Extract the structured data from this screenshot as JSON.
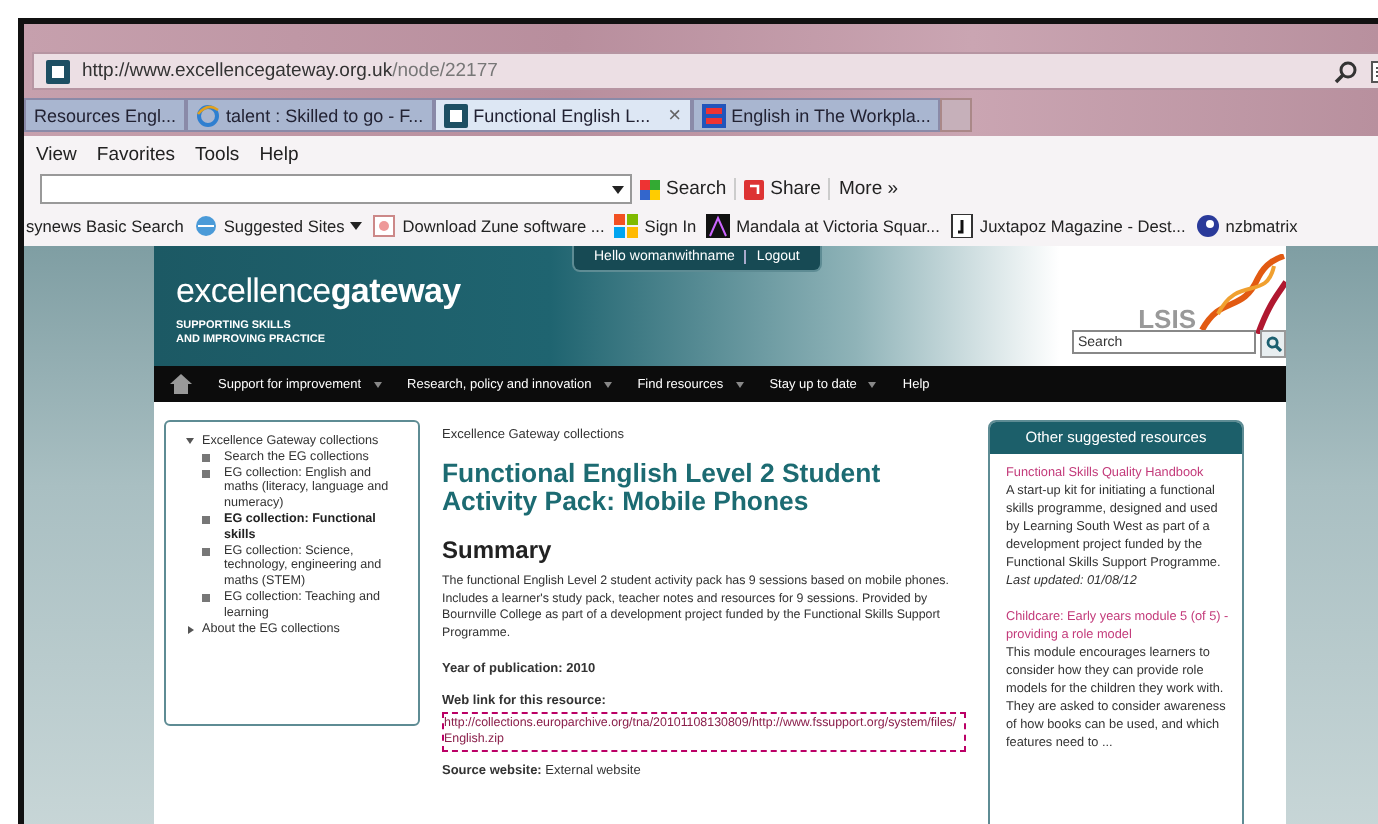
{
  "browser": {
    "url_host": "http://www.excellencegateway.org.uk",
    "url_path": "/node/22177",
    "tabs": [
      {
        "label": "Resources Engl...",
        "selected": false,
        "closable": false
      },
      {
        "label": "talent : Skilled to go - F...",
        "selected": false,
        "closable": false
      },
      {
        "label": "Functional English L...",
        "selected": true,
        "closable": true,
        "close_label": "×"
      },
      {
        "label": "English in The Workpla...",
        "selected": false,
        "closable": false
      }
    ],
    "menu": [
      "View",
      "Favorites",
      "Tools",
      "Help"
    ],
    "toolbar": {
      "search": "Search",
      "share": "Share",
      "more": "More »"
    },
    "favorites": [
      {
        "label": "synews Basic Search",
        "has_menu": false
      },
      {
        "label": "Suggested Sites",
        "has_menu": true
      },
      {
        "label": "Download Zune software ...",
        "has_menu": false
      },
      {
        "label": "Sign In",
        "has_menu": false
      },
      {
        "label": "Mandala at Victoria Squar...",
        "has_menu": false
      },
      {
        "label": "Juxtapoz Magazine - Dest...",
        "has_menu": false
      },
      {
        "label": "nzbmatrix",
        "has_menu": false
      }
    ]
  },
  "site": {
    "greeting": "Hello womanwithname",
    "logout": "Logout",
    "logo": "excellence**gateway**",
    "tagline": [
      "SUPPORTING SKILLS",
      "AND IMPROVING PRACTICE"
    ],
    "partner": "LSIS",
    "search": {
      "placeholder": "Search"
    },
    "nav": [
      {
        "label": "Support for improvement",
        "has_menu": true
      },
      {
        "label": "Research, policy and innovation",
        "has_menu": true
      },
      {
        "label": "Find resources",
        "has_menu": true
      },
      {
        "label": "Stay up to date",
        "has_menu": true
      },
      {
        "label": "Help",
        "has_menu": false
      }
    ]
  },
  "sidebar": {
    "items": [
      {
        "label": "Excellence Gateway collections",
        "expanded": true,
        "selected": false,
        "children": [
          {
            "label": "Search the EG collections",
            "selected": false
          },
          {
            "label": "EG collection: English and maths (literacy, language and numeracy)",
            "selected": false
          },
          {
            "label": "EG collection: Functional skills",
            "selected": true
          },
          {
            "label": "EG collection: Science, technology, engineering and maths (STEM)",
            "selected": false
          },
          {
            "label": "EG collection: Teaching and learning",
            "selected": false
          }
        ]
      },
      {
        "label": "About the EG collections",
        "expanded": false,
        "selected": false
      }
    ]
  },
  "main": {
    "breadcrumb": "Excellence Gateway collections",
    "title": "Functional English Level 2 Student Activity Pack: Mobile Phones",
    "heading": "Summary",
    "summary": "The functional English Level 2 student activity pack has 9 sessions based on mobile phones. Includes a learner's study pack, teacher notes and resources for 9 sessions. Provided by Bournville College as part of a development project funded by the Functional Skills Support Programme.",
    "year": "Year of publication: 2010",
    "web_link_label": "Web link for this resource:",
    "web_link": "http://collections.europarchive.org/tna/20101108130809/http://www.fssupport.org/system/files/English.zip",
    "source": "**Source website:** External website"
  },
  "suggested": {
    "heading": "Other suggested resources",
    "items": [
      {
        "title": "Functional Skills Quality Handbook",
        "description": "A start-up kit for initiating a functional skills programme, designed and used by Learning South West as part of a development project funded by the Functional Skills Support Programme.",
        "updated": "Last updated: 01/08/12"
      },
      {
        "title": "Childcare: Early years module 5 (of 5) - providing a role model",
        "description": "This module encourages learners to consider how they can provide role models for the children they work with. They are asked to consider awareness of how books can be used, and which features need to ..."
      }
    ]
  }
}
